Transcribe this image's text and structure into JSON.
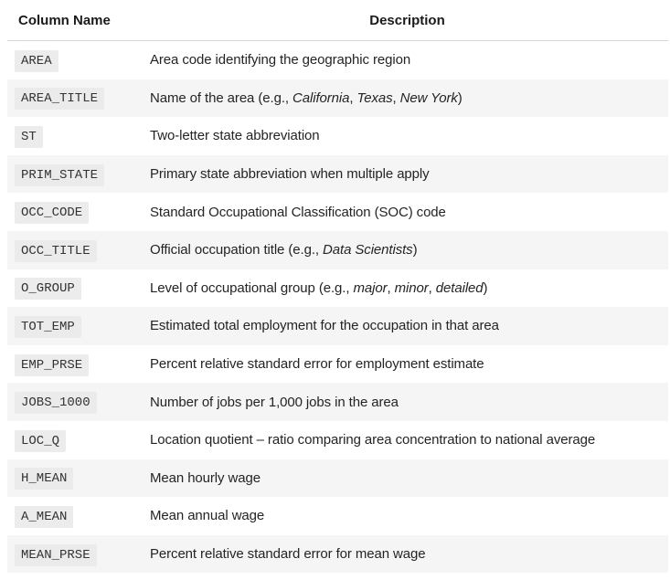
{
  "header": {
    "column_name": "Column Name",
    "description": "Description"
  },
  "rows": [
    {
      "code": "AREA",
      "desc": [
        {
          "t": "Area code identifying the geographic region"
        }
      ]
    },
    {
      "code": "AREA_TITLE",
      "desc": [
        {
          "t": "Name of the area (e.g., "
        },
        {
          "t": "California",
          "i": true
        },
        {
          "t": ", "
        },
        {
          "t": "Texas",
          "i": true
        },
        {
          "t": ", "
        },
        {
          "t": "New York",
          "i": true
        },
        {
          "t": ")"
        }
      ]
    },
    {
      "code": "ST",
      "desc": [
        {
          "t": "Two-letter state abbreviation"
        }
      ]
    },
    {
      "code": "PRIM_STATE",
      "desc": [
        {
          "t": "Primary state abbreviation when multiple apply"
        }
      ]
    },
    {
      "code": "OCC_CODE",
      "desc": [
        {
          "t": "Standard Occupational Classification (SOC) code"
        }
      ]
    },
    {
      "code": "OCC_TITLE",
      "desc": [
        {
          "t": "Official occupation title (e.g., "
        },
        {
          "t": "Data Scientists",
          "i": true
        },
        {
          "t": ")"
        }
      ]
    },
    {
      "code": "O_GROUP",
      "desc": [
        {
          "t": "Level of occupational group (e.g., "
        },
        {
          "t": "major",
          "i": true
        },
        {
          "t": ", "
        },
        {
          "t": "minor",
          "i": true
        },
        {
          "t": ", "
        },
        {
          "t": "detailed",
          "i": true
        },
        {
          "t": ")"
        }
      ]
    },
    {
      "code": "TOT_EMP",
      "desc": [
        {
          "t": "Estimated total employment for the occupation in that area"
        }
      ]
    },
    {
      "code": "EMP_PRSE",
      "desc": [
        {
          "t": "Percent relative standard error for employment estimate"
        }
      ]
    },
    {
      "code": "JOBS_1000",
      "desc": [
        {
          "t": "Number of jobs per 1,000 jobs in the area"
        }
      ]
    },
    {
      "code": "LOC_Q",
      "desc": [
        {
          "t": "Location quotient – ratio comparing area concentration to national average"
        }
      ]
    },
    {
      "code": "H_MEAN",
      "desc": [
        {
          "t": "Mean hourly wage"
        }
      ]
    },
    {
      "code": "A_MEAN",
      "desc": [
        {
          "t": "Mean annual wage"
        }
      ]
    },
    {
      "code": "MEAN_PRSE",
      "desc": [
        {
          "t": "Percent relative standard error for mean wage"
        }
      ]
    }
  ]
}
